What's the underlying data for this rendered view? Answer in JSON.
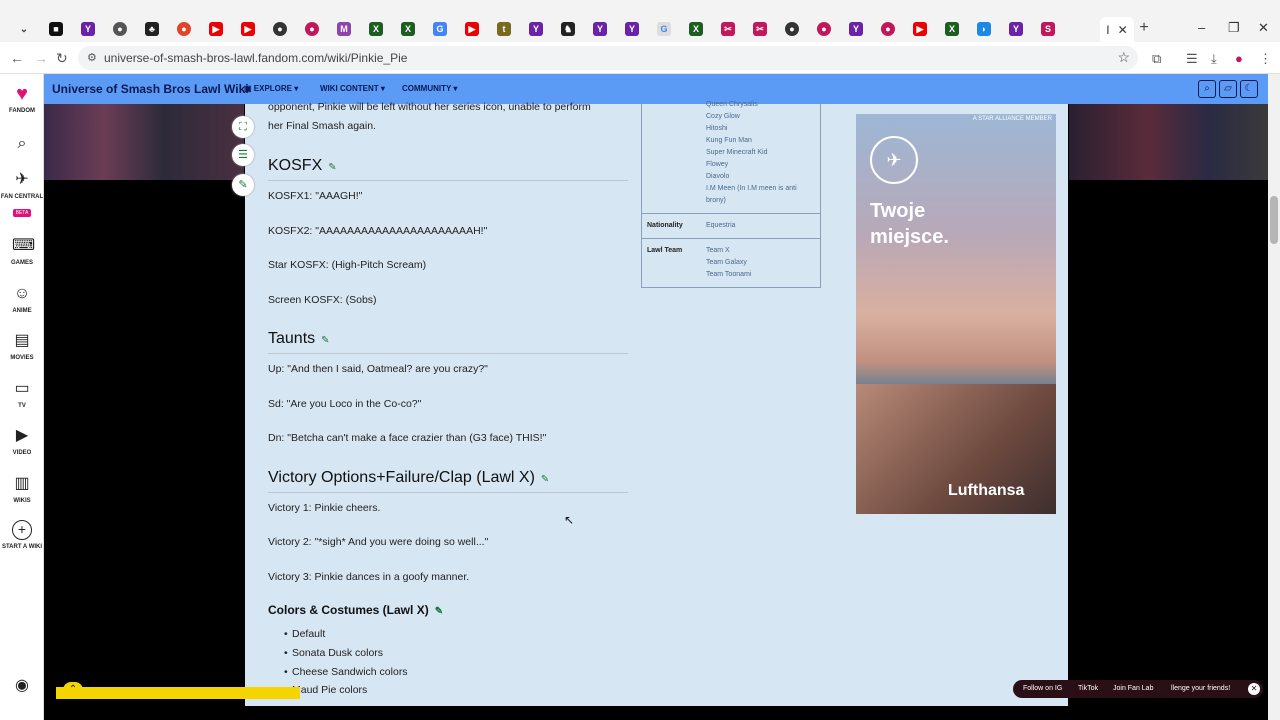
{
  "browser": {
    "active_tab_icon": "I",
    "new_tab": "+",
    "window_controls": [
      "–",
      "❐",
      "✕"
    ],
    "url": "universe-of-smash-bros-lawl.fandom.com/wiki/Pinkie_Pie"
  },
  "rail": {
    "brand": "FANDOM",
    "items": [
      {
        "label": "FAN CENTRAL",
        "badge": "BETA",
        "icon": "rocket-icon"
      },
      {
        "label": "GAMES",
        "icon": "gamepad-icon"
      },
      {
        "label": "ANIME",
        "icon": "tv-face-icon"
      },
      {
        "label": "MOVIES",
        "icon": "clapper-icon"
      },
      {
        "label": "TV",
        "icon": "tv-icon"
      },
      {
        "label": "VIDEO",
        "icon": "play-icon"
      },
      {
        "label": "WIKIS",
        "icon": "book-icon"
      },
      {
        "label": "START A WIKI",
        "icon": "plus-circle-icon"
      }
    ]
  },
  "header": {
    "title": "Universe of Smash Bros Lawl Wiki",
    "nav": [
      "EXPLORE",
      "WIKI CONTENT",
      "COMMUNITY"
    ]
  },
  "article": {
    "intro_1": "opponent, Pinkie will be left without her series icon, unable to perform",
    "intro_2": "her Final Smash again.",
    "kosfx_heading": "KOSFX",
    "kosfx": [
      "KOSFX1: \"AAAGH!\"",
      "KOSFX2: \"AAAAAAAAAAAAAAAAAAAAAAH!\"",
      "Star KOSFX: (High-Pitch Scream)",
      "Screen KOSFX: (Sobs)"
    ],
    "taunts_heading": "Taunts",
    "taunts": [
      "Up: \"And then I said, Oatmeal? are you crazy?\"",
      "Sd: \"Are you Loco in the Co-co?\"",
      "Dn: \"Betcha can't make a face crazier than (G3 face) THIS!\""
    ],
    "victory_heading": "Victory Options+Failure/Clap (Lawl X)",
    "victory": [
      "Victory 1: Pinkie cheers.",
      "Victory 2: \"*sigh* And you were doing so well...\"",
      "Victory 3: Pinkie dances in a goofy manner."
    ],
    "colors_heading": "Colors & Costumes (Lawl X)",
    "colors": [
      "Default",
      "Sonata Dusk colors",
      "Cheese Sandwich colors",
      "Maud Pie colors"
    ]
  },
  "infobox": {
    "list": [
      "Queen Chrysalis",
      "Cozy Glow",
      "Hitoshi",
      "Kung Fun Man",
      "Super Minecraft Kid",
      "Flowey",
      "Diavolo",
      "I.M Meen (In I.M meen is anti",
      "brony)"
    ],
    "nationality_label": "Nationality",
    "nationality": "Equestria",
    "team_label": "Lawl Team",
    "teams": [
      "Team X",
      "Team Galaxy",
      "Team Toonami"
    ]
  },
  "ad": {
    "headline_1": "Twoje",
    "headline_2": "miejsce.",
    "brand": "Lufthansa",
    "tag": "A STAR ALLIANCE MEMBER"
  },
  "footer": {
    "links": [
      "Follow on IG",
      "TikTok",
      "Join Fan Lab",
      "llenge your friends!"
    ]
  },
  "colors": {
    "header_bg": "#5b9bf5",
    "content_bg": "#d7e6f3",
    "accent_green": "#1a7a3a"
  }
}
